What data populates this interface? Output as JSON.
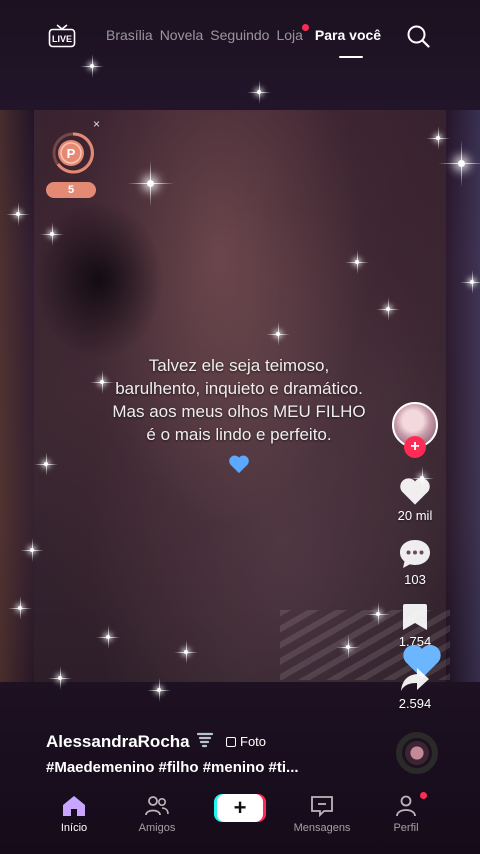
{
  "top_nav": {
    "live_label": "LIVE",
    "tabs": [
      {
        "label": "Brasília",
        "active": false,
        "dot": false
      },
      {
        "label": "Novela",
        "active": false,
        "dot": false
      },
      {
        "label": "Seguindo",
        "active": false,
        "dot": false
      },
      {
        "label": "Loja",
        "active": false,
        "dot": true
      },
      {
        "label": "Para você",
        "active": true,
        "dot": false
      }
    ],
    "search_icon": "search-icon"
  },
  "coin_widget": {
    "letter": "P",
    "count": "5",
    "close": "×"
  },
  "post": {
    "caption_lines": [
      "Talvez ele seja teimoso,",
      "barulhento, inquieto e dramático.",
      "Mas aos meus olhos MEU FILHO",
      "é o mais lindo e perfeito."
    ],
    "author": "AlessandraRocha",
    "badge": "Foto",
    "hashtags": "#Maedemenino #filho #menino #ti..."
  },
  "actions": {
    "likes": "20 mil",
    "comments": "103",
    "saves": "1.754",
    "shares": "2.594"
  },
  "bottom_nav": {
    "home": "Início",
    "friends": "Amigos",
    "create": "+",
    "messages": "Mensagens",
    "profile": "Perfil"
  },
  "colors": {
    "accent": "#fe2c55",
    "cyan": "#25f4ee",
    "coin": "#e48a74",
    "home_active": "#c8a6ff",
    "blue_heart": "#5aa8ff"
  }
}
